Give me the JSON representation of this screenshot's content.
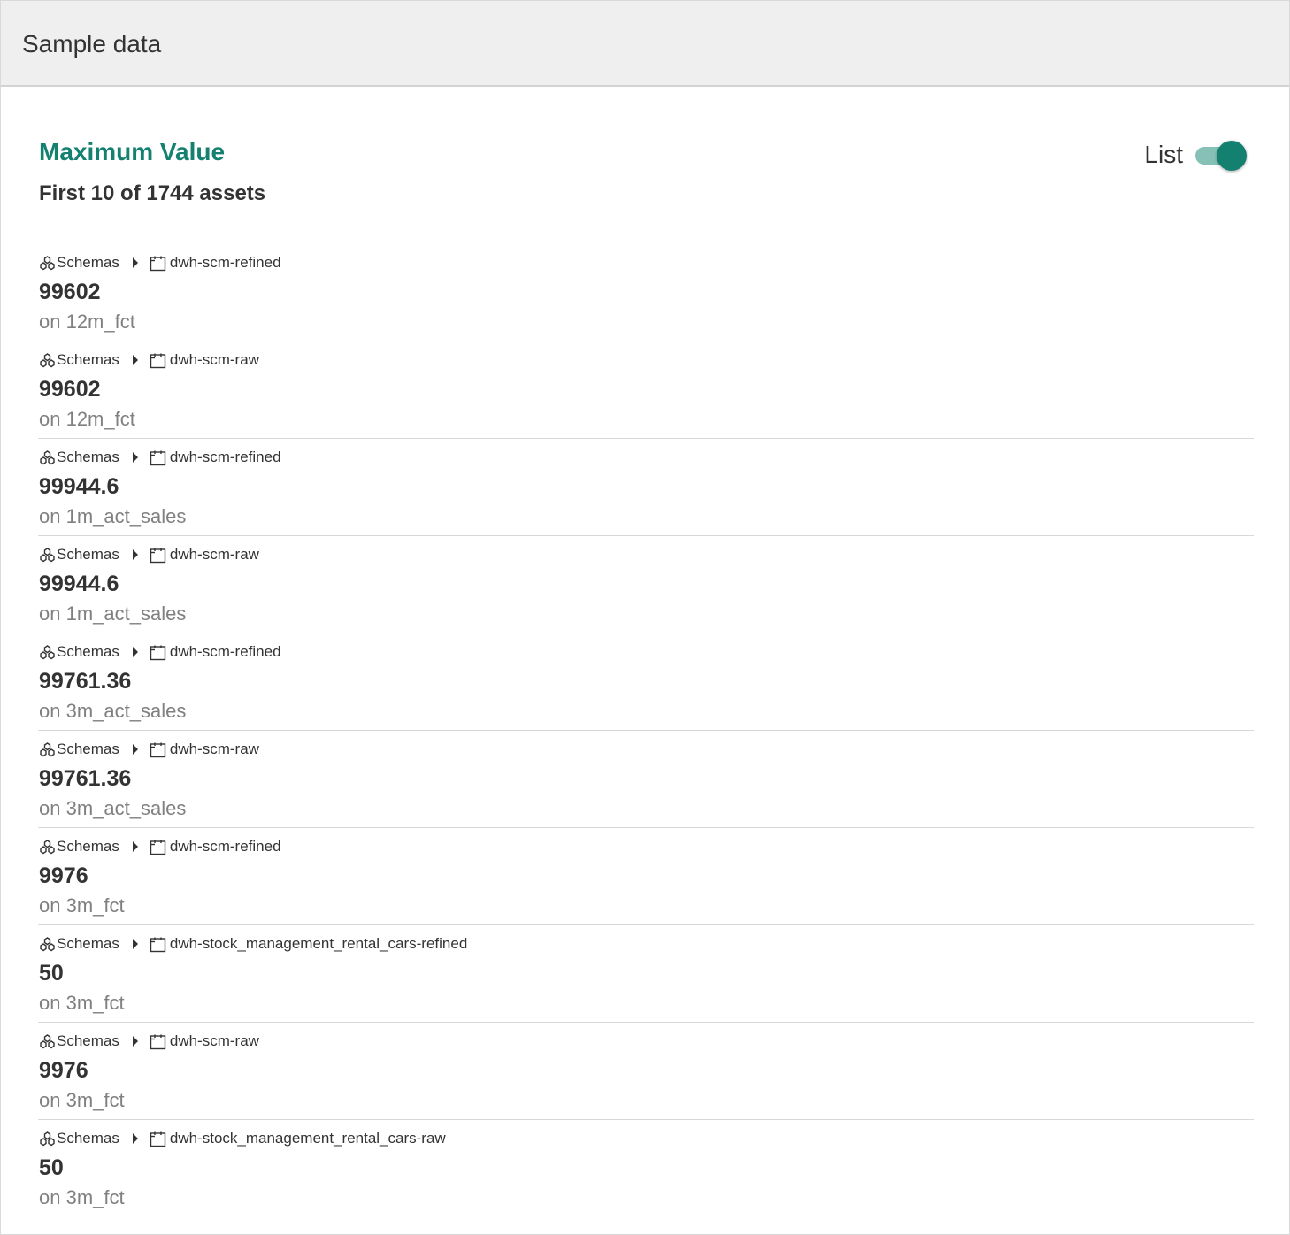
{
  "header": {
    "title": "Sample data"
  },
  "section": {
    "title": "Maximum Value",
    "subtitle": "First 10 of 1744 assets"
  },
  "toggle": {
    "label": "List",
    "on": true
  },
  "colors": {
    "accent": "#138070",
    "accent_light": "#86c0b6"
  },
  "items": [
    {
      "crumb_root": "Schemas",
      "crumb_leaf": "dwh-scm-refined",
      "value": "99602",
      "on": "on 12m_fct"
    },
    {
      "crumb_root": "Schemas",
      "crumb_leaf": "dwh-scm-raw",
      "value": "99602",
      "on": "on 12m_fct"
    },
    {
      "crumb_root": "Schemas",
      "crumb_leaf": "dwh-scm-refined",
      "value": "99944.6",
      "on": "on 1m_act_sales"
    },
    {
      "crumb_root": "Schemas",
      "crumb_leaf": "dwh-scm-raw",
      "value": "99944.6",
      "on": "on 1m_act_sales"
    },
    {
      "crumb_root": "Schemas",
      "crumb_leaf": "dwh-scm-refined",
      "value": "99761.36",
      "on": "on 3m_act_sales"
    },
    {
      "crumb_root": "Schemas",
      "crumb_leaf": "dwh-scm-raw",
      "value": "99761.36",
      "on": "on 3m_act_sales"
    },
    {
      "crumb_root": "Schemas",
      "crumb_leaf": "dwh-scm-refined",
      "value": "9976",
      "on": "on 3m_fct"
    },
    {
      "crumb_root": "Schemas",
      "crumb_leaf": "dwh-stock_management_rental_cars-refined",
      "value": "50",
      "on": "on 3m_fct"
    },
    {
      "crumb_root": "Schemas",
      "crumb_leaf": "dwh-scm-raw",
      "value": "9976",
      "on": "on 3m_fct"
    },
    {
      "crumb_root": "Schemas",
      "crumb_leaf": "dwh-stock_management_rental_cars-raw",
      "value": "50",
      "on": "on 3m_fct"
    }
  ]
}
